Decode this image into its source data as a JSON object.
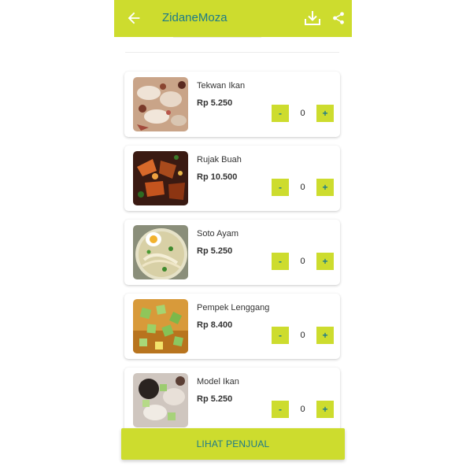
{
  "colors": {
    "accent": "#cddc2e",
    "accent_text": "#1c7a8a"
  },
  "appbar": {
    "title": "ZidaneMoza",
    "back_icon": "arrow-left-icon",
    "download_icon": "download-icon",
    "share_icon": "share-icon"
  },
  "items": [
    {
      "name": "Tekwan Ikan",
      "price": "Rp 5.250",
      "qty": "0",
      "minus": "-",
      "plus": "+"
    },
    {
      "name": "Rujak Buah",
      "price": "Rp 10.500",
      "qty": "0",
      "minus": "-",
      "plus": "+"
    },
    {
      "name": "Soto Ayam",
      "price": "Rp 5.250",
      "qty": "0",
      "minus": "-",
      "plus": "+"
    },
    {
      "name": "Pempek Lenggang",
      "price": "Rp 8.400",
      "qty": "0",
      "minus": "-",
      "plus": "+"
    },
    {
      "name": "Model Ikan",
      "price": "Rp 5.250",
      "qty": "0",
      "minus": "-",
      "plus": "+"
    }
  ],
  "cta": {
    "label": "LIHAT PENJUAL"
  }
}
